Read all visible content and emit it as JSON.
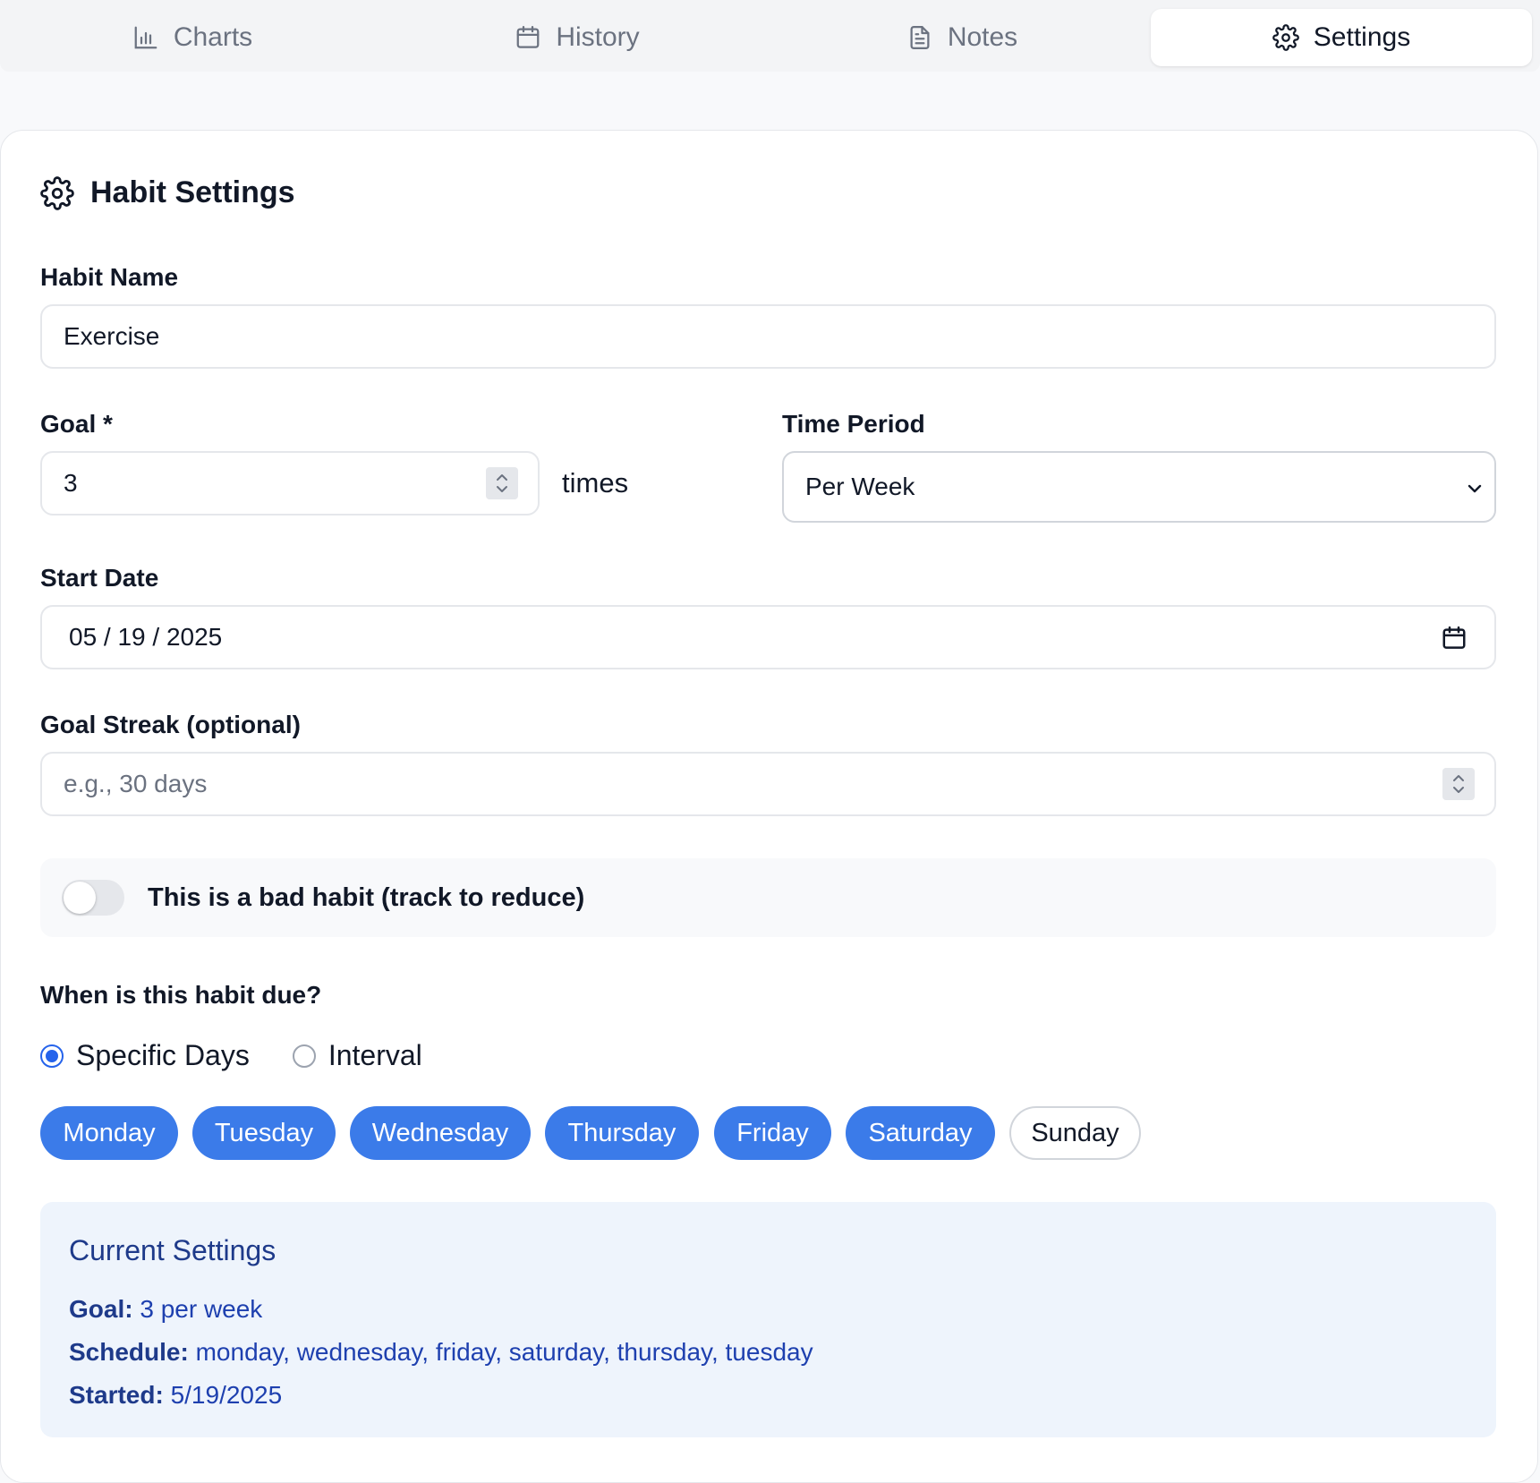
{
  "tabs": [
    {
      "label": "Charts",
      "icon": "bar-chart-icon"
    },
    {
      "label": "History",
      "icon": "calendar-icon"
    },
    {
      "label": "Notes",
      "icon": "document-icon"
    },
    {
      "label": "Settings",
      "icon": "gear-icon",
      "active": true
    }
  ],
  "card": {
    "title": "Habit Settings",
    "habit_name": {
      "label": "Habit Name",
      "value": "Exercise"
    },
    "goal": {
      "label": "Goal *",
      "value": "3",
      "unit": "times"
    },
    "time_period": {
      "label": "Time Period",
      "value": "Per Week"
    },
    "start_date": {
      "label": "Start Date",
      "value": "05 / 19 / 2025"
    },
    "goal_streak": {
      "label": "Goal Streak (optional)",
      "placeholder": "e.g., 30 days"
    },
    "bad_habit": {
      "label": "This is a bad habit (track to reduce)",
      "enabled": false
    },
    "due": {
      "label": "When is this habit due?",
      "options": [
        {
          "label": "Specific Days",
          "selected": true
        },
        {
          "label": "Interval",
          "selected": false
        }
      ],
      "days": [
        {
          "label": "Monday",
          "selected": true
        },
        {
          "label": "Tuesday",
          "selected": true
        },
        {
          "label": "Wednesday",
          "selected": true
        },
        {
          "label": "Thursday",
          "selected": true
        },
        {
          "label": "Friday",
          "selected": true
        },
        {
          "label": "Saturday",
          "selected": true
        },
        {
          "label": "Sunday",
          "selected": false
        }
      ]
    },
    "summary": {
      "title": "Current Settings",
      "goal_label": "Goal:",
      "goal_value": "3 per week",
      "schedule_label": "Schedule:",
      "schedule_value": "monday, wednesday, friday, saturday, thursday, tuesday",
      "started_label": "Started:",
      "started_value": "5/19/2025"
    }
  },
  "colors": {
    "accent": "#3b7be9",
    "summary_bg": "#eef4fc",
    "summary_text": "#1e40af"
  }
}
